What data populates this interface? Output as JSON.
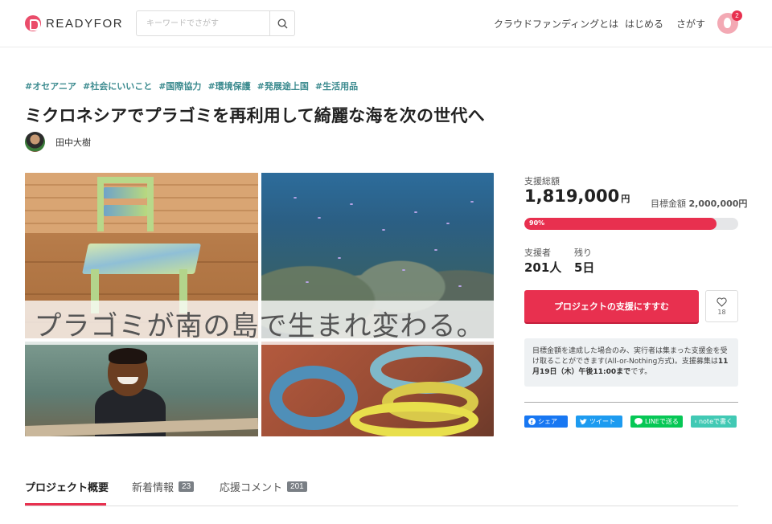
{
  "header": {
    "logo_text": "READYFOR",
    "search_placeholder": "キーワードでさがす",
    "nav": [
      "クラウドファンディングとは",
      "はじめる",
      "さがす"
    ],
    "notification_count": "2"
  },
  "project": {
    "tags": [
      "#オセアニア",
      "#社会にいいこと",
      "#国際協力",
      "#環境保護",
      "#発展途上国",
      "#生活用品"
    ],
    "title": "ミクロネシアでプラゴミを再利用して綺麗な海を次の世代へ",
    "owner_name": "田中大樹",
    "hero_caption": "プラゴミが南の島で生まれ変わる。"
  },
  "funding": {
    "total_label": "支援総額",
    "total_amount": "1,819,000",
    "currency": "円",
    "goal_label": "目標金額",
    "goal_amount": "2,000,000円",
    "progress_percent": 90,
    "progress_label": "90%",
    "backers_label": "支援者",
    "backers_value": "201人",
    "remaining_label": "残り",
    "remaining_value": "5日",
    "support_button": "プロジェクトの支援にすすむ",
    "favorite_count": "18",
    "note_text_1": "目標金額を達成した場合のみ、実行者は集まった支援金を受け取ることができます(All-or-Nothing方式)。支援募集は",
    "note_text_bold": "11月19日（木）午後11:00まで",
    "note_text_2": "です。"
  },
  "share": {
    "facebook": "シェア",
    "twitter": "ツイート",
    "line": "LINEで送る",
    "note": "noteで書く"
  },
  "tabs": [
    {
      "label": "プロジェクト概要",
      "count": ""
    },
    {
      "label": "新着情報",
      "count": "23"
    },
    {
      "label": "応援コメント",
      "count": "201"
    }
  ],
  "colors": {
    "accent": "#e8304f",
    "tag": "#3c8b8f",
    "facebook": "#1877f2",
    "twitter": "#1d9bf0",
    "line": "#06c755",
    "note": "#41c9b4"
  }
}
